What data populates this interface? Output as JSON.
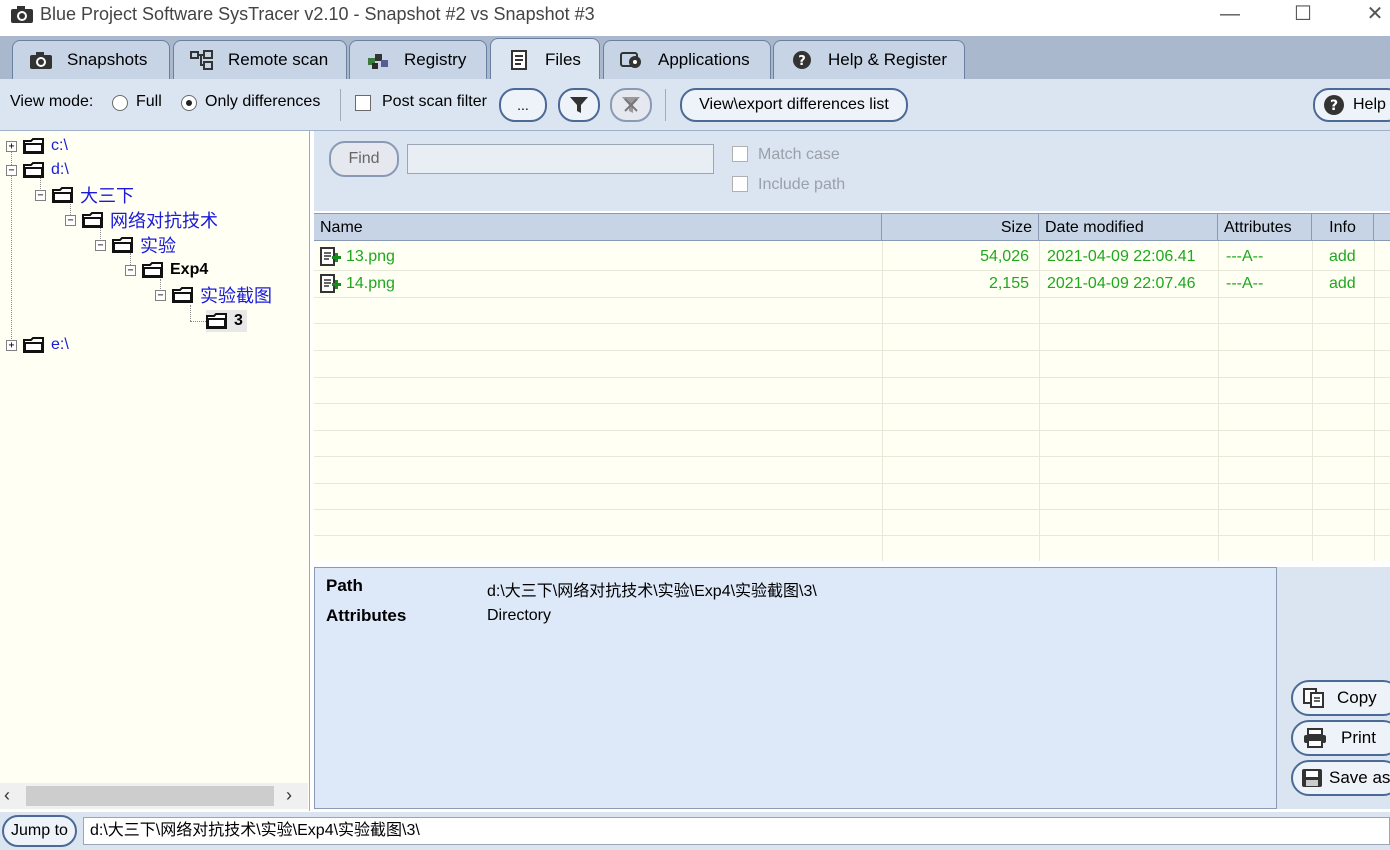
{
  "window": {
    "title": "Blue Project Software SysTracer v2.10 - Snapshot #2 vs Snapshot #3",
    "minimize": "—",
    "maximize": "☐",
    "close": "✕"
  },
  "tabs": [
    {
      "label": "Snapshots",
      "icon": "camera-icon"
    },
    {
      "label": "Remote scan",
      "icon": "network-icon"
    },
    {
      "label": "Registry",
      "icon": "registry-icon"
    },
    {
      "label": "Files",
      "icon": "files-icon",
      "active": true
    },
    {
      "label": "Applications",
      "icon": "applications-icon"
    },
    {
      "label": "Help & Register",
      "icon": "help-icon"
    }
  ],
  "toolbar": {
    "view_mode_label": "View mode:",
    "full_label": "Full",
    "only_diff_label": "Only differences",
    "selected_mode": "Only differences",
    "post_scan_filter_label": "Post scan filter",
    "post_scan_filter_checked": false,
    "ellipsis_label": "...",
    "view_export_label": "View\\export differences list",
    "help_label": "Help"
  },
  "tree": {
    "nodes": [
      {
        "label": "c:\\",
        "expander": "+"
      },
      {
        "label": "d:\\",
        "expander": "−"
      },
      {
        "label": "大三下",
        "expander": "−"
      },
      {
        "label": "网络对抗技术",
        "expander": "−"
      },
      {
        "label": "实验",
        "expander": "−"
      },
      {
        "label": "Exp4",
        "expander": "−"
      },
      {
        "label": "实验截图",
        "expander": "−"
      },
      {
        "label": "3",
        "expander": ""
      },
      {
        "label": "e:\\",
        "expander": "+"
      }
    ]
  },
  "find": {
    "button_label": "Find",
    "input_value": "",
    "match_case_label": "Match case",
    "include_path_label": "Include path"
  },
  "grid": {
    "columns": [
      "Name",
      "Size",
      "Date modified",
      "Attributes",
      "Info"
    ],
    "rows": [
      {
        "name": "13.png",
        "size": "54,026",
        "date": "2021-04-09 22:06.41",
        "attributes": "---A--",
        "info": "add"
      },
      {
        "name": "14.png",
        "size": "2,155",
        "date": "2021-04-09 22:07.46",
        "attributes": "---A--",
        "info": "add"
      }
    ],
    "add_color": "#1fa81f"
  },
  "detail": {
    "path_label": "Path",
    "path_value": "d:\\大三下\\网络对抗技术\\实验\\Exp4\\实验截图\\3\\",
    "attributes_label": "Attributes",
    "attributes_value": "Directory"
  },
  "side_buttons": {
    "copy_label": "Copy",
    "print_label": "Print",
    "save_label": "Save as"
  },
  "statusbar": {
    "jump_label": "Jump to",
    "path_value": "d:\\大三下\\网络对抗技术\\实验\\Exp4\\实验截图\\3\\"
  },
  "colors": {
    "accent": "#4b6a96",
    "tree_link": "#1a1adc",
    "panel": "#dbe5f1"
  }
}
